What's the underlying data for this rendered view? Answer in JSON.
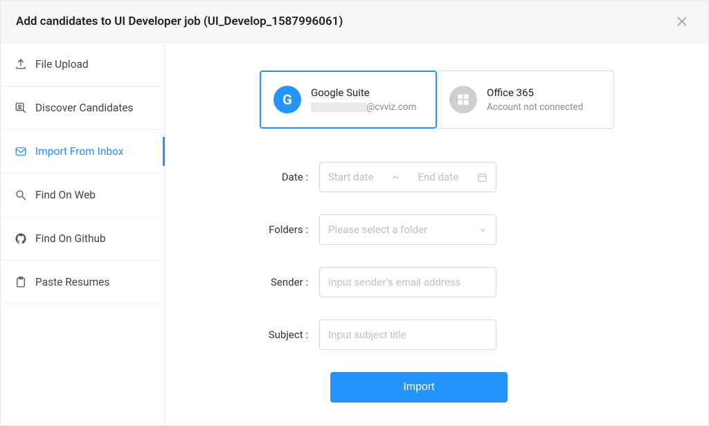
{
  "header": {
    "title": "Add candidates to UI Developer job (UI_Develop_1587996061)"
  },
  "sidebar": {
    "items": [
      {
        "icon": "upload-icon",
        "label": "File Upload",
        "active": false
      },
      {
        "icon": "search-user-icon",
        "label": "Discover Candidates",
        "active": false
      },
      {
        "icon": "mail-icon",
        "label": "Import From Inbox",
        "active": true
      },
      {
        "icon": "search-icon",
        "label": "Find On Web",
        "active": false
      },
      {
        "icon": "github-icon",
        "label": "Find On Github",
        "active": false
      },
      {
        "icon": "paste-icon",
        "label": "Paste Resumes",
        "active": false
      }
    ]
  },
  "providers": {
    "google": {
      "title": "Google Suite",
      "email_suffix": "@cvviz.com",
      "selected": true
    },
    "office": {
      "title": "Office 365",
      "subtitle": "Account not connected",
      "selected": false
    }
  },
  "form": {
    "date": {
      "label": "Date :",
      "start_placeholder": "Start date",
      "separator": "~",
      "end_placeholder": "End date"
    },
    "folders": {
      "label": "Folders :",
      "placeholder": "Please select a folder"
    },
    "sender": {
      "label": "Sender :",
      "placeholder": "Input sender's email address",
      "value": ""
    },
    "subject": {
      "label": "Subject :",
      "placeholder": "Input subject title",
      "value": ""
    },
    "submit_label": "Import"
  }
}
